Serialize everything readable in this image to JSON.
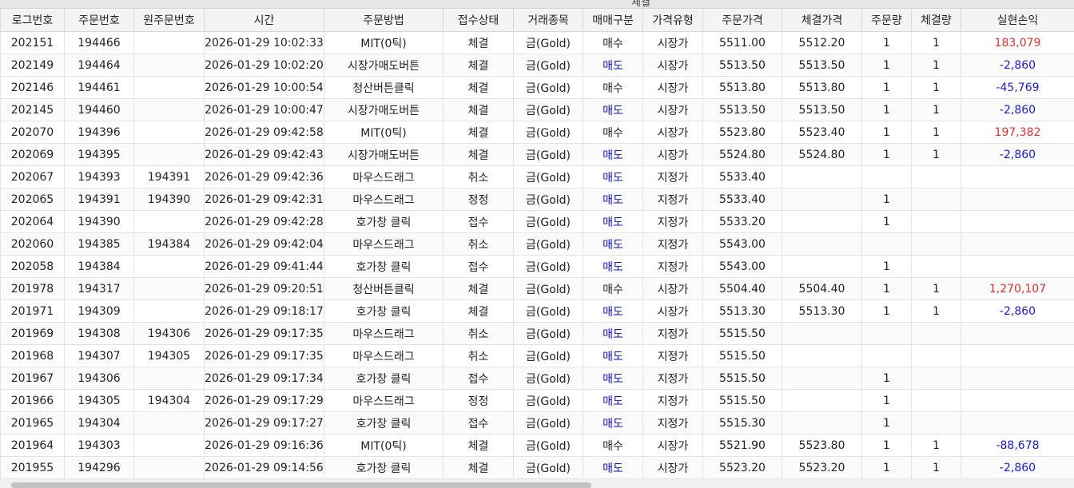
{
  "window": {
    "caption": "체결"
  },
  "columns": [
    "로그번호",
    "주문번호",
    "원주문번호",
    "시간",
    "주문방법",
    "접수상태",
    "거래종목",
    "매매구분",
    "가격유형",
    "주문가격",
    "체결가격",
    "주문량",
    "체결량",
    "실현손익"
  ],
  "rows": [
    [
      "202151",
      "194466",
      "",
      "2026-01-29 10:02:33",
      "MIT(0틱)",
      "체결",
      "금(Gold)",
      "매수",
      "시장가",
      "5511.00",
      "5512.20",
      "1",
      "1",
      "183,079"
    ],
    [
      "202149",
      "194464",
      "",
      "2026-01-29 10:02:20",
      "시장가매도버튼",
      "체결",
      "금(Gold)",
      "매도",
      "시장가",
      "5513.50",
      "5513.50",
      "1",
      "1",
      "-2,860"
    ],
    [
      "202146",
      "194461",
      "",
      "2026-01-29 10:00:54",
      "청산버튼클릭",
      "체결",
      "금(Gold)",
      "매수",
      "시장가",
      "5513.80",
      "5513.80",
      "1",
      "1",
      "-45,769"
    ],
    [
      "202145",
      "194460",
      "",
      "2026-01-29 10:00:47",
      "시장가매도버튼",
      "체결",
      "금(Gold)",
      "매도",
      "시장가",
      "5513.50",
      "5513.50",
      "1",
      "1",
      "-2,860"
    ],
    [
      "202070",
      "194396",
      "",
      "2026-01-29 09:42:58",
      "MIT(0틱)",
      "체결",
      "금(Gold)",
      "매수",
      "시장가",
      "5523.80",
      "5523.40",
      "1",
      "1",
      "197,382"
    ],
    [
      "202069",
      "194395",
      "",
      "2026-01-29 09:42:43",
      "시장가매도버튼",
      "체결",
      "금(Gold)",
      "매도",
      "시장가",
      "5524.80",
      "5524.80",
      "1",
      "1",
      "-2,860"
    ],
    [
      "202067",
      "194393",
      "194391",
      "2026-01-29 09:42:36",
      "마우스드래그",
      "취소",
      "금(Gold)",
      "매도",
      "지정가",
      "5533.40",
      "",
      "",
      "",
      ""
    ],
    [
      "202065",
      "194391",
      "194390",
      "2026-01-29 09:42:31",
      "마우스드래그",
      "정정",
      "금(Gold)",
      "매도",
      "지정가",
      "5533.40",
      "",
      "1",
      "",
      ""
    ],
    [
      "202064",
      "194390",
      "",
      "2026-01-29 09:42:28",
      "호가창 클릭",
      "접수",
      "금(Gold)",
      "매도",
      "지정가",
      "5533.20",
      "",
      "1",
      "",
      ""
    ],
    [
      "202060",
      "194385",
      "194384",
      "2026-01-29 09:42:04",
      "마우스드래그",
      "취소",
      "금(Gold)",
      "매도",
      "지정가",
      "5543.00",
      "",
      "",
      "",
      ""
    ],
    [
      "202058",
      "194384",
      "",
      "2026-01-29 09:41:44",
      "호가창 클릭",
      "접수",
      "금(Gold)",
      "매도",
      "지정가",
      "5543.00",
      "",
      "1",
      "",
      ""
    ],
    [
      "201978",
      "194317",
      "",
      "2026-01-29 09:20:51",
      "청산버튼클릭",
      "체결",
      "금(Gold)",
      "매수",
      "시장가",
      "5504.40",
      "5504.40",
      "1",
      "1",
      "1,270,107"
    ],
    [
      "201971",
      "194309",
      "",
      "2026-01-29 09:18:17",
      "호가창 클릭",
      "체결",
      "금(Gold)",
      "매도",
      "시장가",
      "5513.30",
      "5513.30",
      "1",
      "1",
      "-2,860"
    ],
    [
      "201969",
      "194308",
      "194306",
      "2026-01-29 09:17:35",
      "마우스드래그",
      "취소",
      "금(Gold)",
      "매도",
      "지정가",
      "5515.50",
      "",
      "",
      "",
      ""
    ],
    [
      "201968",
      "194307",
      "194305",
      "2026-01-29 09:17:35",
      "마우스드래그",
      "취소",
      "금(Gold)",
      "매도",
      "지정가",
      "5515.50",
      "",
      "",
      "",
      ""
    ],
    [
      "201967",
      "194306",
      "",
      "2026-01-29 09:17:34",
      "호가창 클릭",
      "접수",
      "금(Gold)",
      "매도",
      "지정가",
      "5515.50",
      "",
      "1",
      "",
      ""
    ],
    [
      "201966",
      "194305",
      "194304",
      "2026-01-29 09:17:29",
      "마우스드래그",
      "정정",
      "금(Gold)",
      "매도",
      "지정가",
      "5515.50",
      "",
      "1",
      "",
      ""
    ],
    [
      "201965",
      "194304",
      "",
      "2026-01-29 09:17:27",
      "호가창 클릭",
      "접수",
      "금(Gold)",
      "매도",
      "지정가",
      "5515.30",
      "",
      "1",
      "",
      ""
    ],
    [
      "201964",
      "194303",
      "",
      "2026-01-29 09:16:36",
      "MIT(0틱)",
      "체결",
      "금(Gold)",
      "매수",
      "시장가",
      "5521.90",
      "5523.80",
      "1",
      "1",
      "-88,678"
    ],
    [
      "201955",
      "194296",
      "",
      "2026-01-29 09:14:56",
      "호가창 클릭",
      "체결",
      "금(Gold)",
      "매도",
      "시장가",
      "5523.20",
      "5523.20",
      "1",
      "1",
      "-2,860"
    ]
  ],
  "colors": {
    "sell": "#1010cc",
    "profit": "#e03030",
    "loss": "#1a1ad6"
  }
}
